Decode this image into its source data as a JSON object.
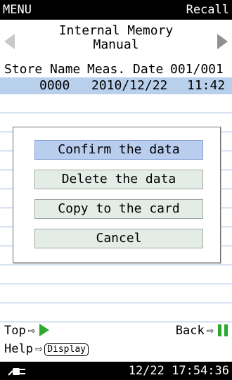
{
  "topbar": {
    "menu": "MENU",
    "recall": "Recall"
  },
  "nav": {
    "title_line1": "Internal Memory",
    "title_line2": "Manual"
  },
  "columns": {
    "store_name": "Store Name",
    "meas_date": "Meas. Date",
    "page": "001/001"
  },
  "records": [
    {
      "store": "0000",
      "date": "2010/12/22",
      "time": "11:42"
    }
  ],
  "dialog": {
    "options": [
      "Confirm the data",
      "Delete the data",
      "Copy to the card",
      "Cancel"
    ],
    "selected_index": 0
  },
  "footer": {
    "top_label": "Top",
    "back_label": "Back",
    "help_label": "Help",
    "display_button": "Display",
    "arrow": "⇨"
  },
  "statusbar": {
    "datetime": "12/22 17:54:36",
    "icon": "power-plug-icon"
  },
  "colors": {
    "highlight": "#b8d0ec",
    "selected_option": "#b9cdee",
    "option_bg": "#e3ece6",
    "green": "#2ea82e"
  }
}
